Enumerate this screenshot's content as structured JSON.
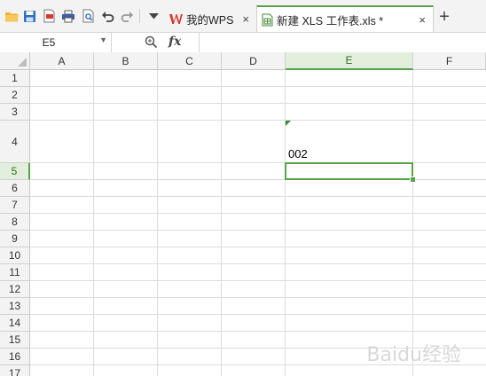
{
  "quick_access": [
    {
      "name": "open-folder-icon",
      "glyph": "📂"
    },
    {
      "name": "save-icon",
      "glyph": "💾"
    },
    {
      "name": "export-pdf-icon",
      "glyph": "🗎"
    },
    {
      "name": "print-icon",
      "glyph": "🖶"
    },
    {
      "name": "print-preview-icon",
      "glyph": "🔍"
    },
    {
      "name": "undo-icon",
      "glyph": "↶"
    },
    {
      "name": "redo-icon",
      "glyph": "↷"
    }
  ],
  "tabs": {
    "wps_label": "我的WPS",
    "doc_label": "新建 XLS 工作表.xls *",
    "close_glyph": "×",
    "new_tab_glyph": "+"
  },
  "formula_bar": {
    "name_box": "E5",
    "fx_label": "fx",
    "formula_value": ""
  },
  "sheet": {
    "columns": [
      "A",
      "B",
      "C",
      "D",
      "E",
      "F"
    ],
    "rows": [
      "1",
      "2",
      "3",
      "4",
      "5",
      "6",
      "7",
      "8",
      "9",
      "10",
      "11",
      "12",
      "13",
      "14",
      "15",
      "16",
      "17"
    ],
    "selected_column": "E",
    "selected_row": "5",
    "cells": [
      {
        "ref": "E4",
        "value": "002"
      }
    ]
  },
  "colors": {
    "accent": "#58a34a",
    "wps_red": "#d83b2d",
    "header_bg": "#f3f3f3"
  },
  "watermark": "Baidu经验"
}
